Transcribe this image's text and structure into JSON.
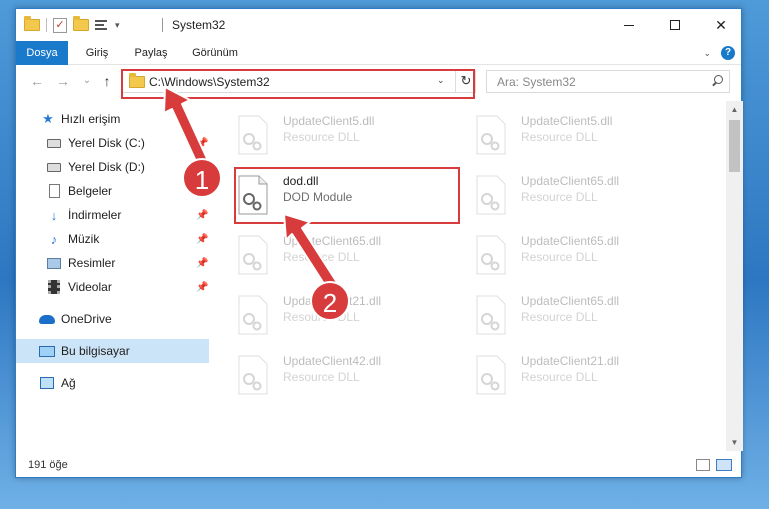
{
  "window": {
    "title": "System32",
    "controls": {
      "minimize": "minimize",
      "maximize": "maximize",
      "close": "✕"
    }
  },
  "ribbon": {
    "tabs": [
      "Dosya",
      "Giriş",
      "Paylaş",
      "Görünüm"
    ]
  },
  "navigation": {
    "back": "←",
    "forward": "→",
    "recent": "⌄",
    "up": "↑",
    "address": "C:\\Windows\\System32",
    "refresh": "↻",
    "search_placeholder": "Ara: System32"
  },
  "sidebar": {
    "items": [
      {
        "label": "Hızlı erişim",
        "icon": "star-icon",
        "pinned": false
      },
      {
        "label": "Yerel Disk (C:)",
        "icon": "disk-icon",
        "pinned": true
      },
      {
        "label": "Yerel Disk (D:)",
        "icon": "disk-icon",
        "pinned": false
      },
      {
        "label": "Belgeler",
        "icon": "document-icon",
        "pinned": true
      },
      {
        "label": "İndirmeler",
        "icon": "download-icon",
        "pinned": true
      },
      {
        "label": "Müzik",
        "icon": "music-icon",
        "pinned": true
      },
      {
        "label": "Resimler",
        "icon": "pictures-icon",
        "pinned": true
      },
      {
        "label": "Videolar",
        "icon": "video-icon",
        "pinned": true
      },
      {
        "label": "OneDrive",
        "icon": "cloud-icon",
        "pinned": false
      },
      {
        "label": "Bu bilgisayar",
        "icon": "computer-icon",
        "pinned": false,
        "selected": true
      },
      {
        "label": "Ağ",
        "icon": "network-icon",
        "pinned": false
      }
    ]
  },
  "files": [
    {
      "name": "UpdateClient5.dll",
      "desc": "Resource DLL",
      "faded": true
    },
    {
      "name": "UpdateClient5.dll",
      "desc": "Resource DLL",
      "faded": true
    },
    {
      "name": "dod.dll",
      "desc": "DOD Module",
      "faded": false,
      "highlighted": true
    },
    {
      "name": "UpdateClient65.dll",
      "desc": "Resource DLL",
      "faded": true
    },
    {
      "name": "UpdateClient65.dll",
      "desc": "Resource DLL",
      "faded": true
    },
    {
      "name": "UpdateClient65.dll",
      "desc": "Resource DLL",
      "faded": true
    },
    {
      "name": "UpdateClient21.dll",
      "desc": "Resource DLL",
      "faded": true
    },
    {
      "name": "UpdateClient65.dll",
      "desc": "Resource DLL",
      "faded": true
    },
    {
      "name": "UpdateClient42.dll",
      "desc": "Resource DLL",
      "faded": true
    },
    {
      "name": "UpdateClient21.dll",
      "desc": "Resource DLL",
      "faded": true
    }
  ],
  "status": {
    "count": "191 öğe"
  },
  "annotations": {
    "step1": "1",
    "step2": "2",
    "color": "#d83b3b"
  }
}
